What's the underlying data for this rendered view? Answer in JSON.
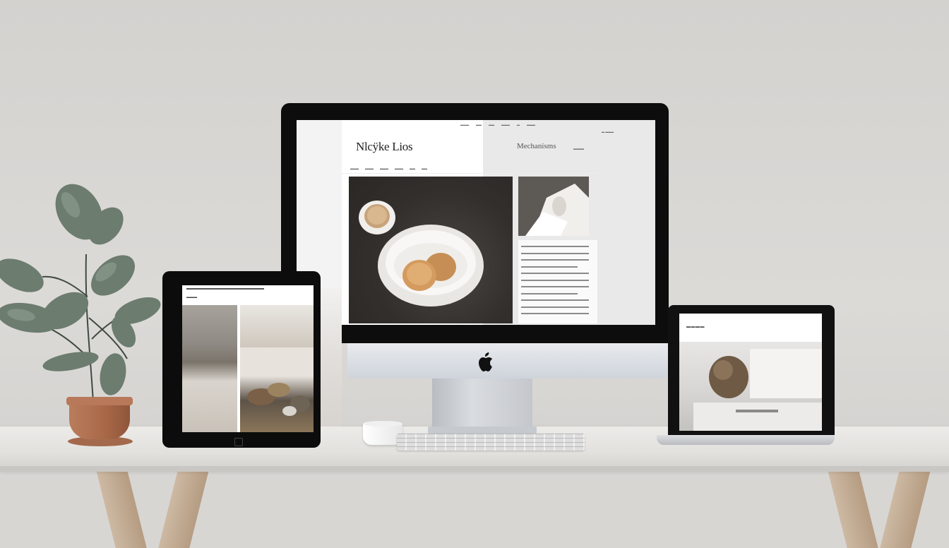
{
  "imac": {
    "site_title": "Nlcÿke Lios",
    "header_tagline": "Mechanisms"
  },
  "colors": {
    "wall": "#d8d6d3",
    "desk": "#e8e7e4",
    "device_frame": "#0d0d0d",
    "plant_leaf": "#6f7f72",
    "pot": "#a86848"
  },
  "icons": {
    "apple_logo": "apple-logo-icon"
  }
}
